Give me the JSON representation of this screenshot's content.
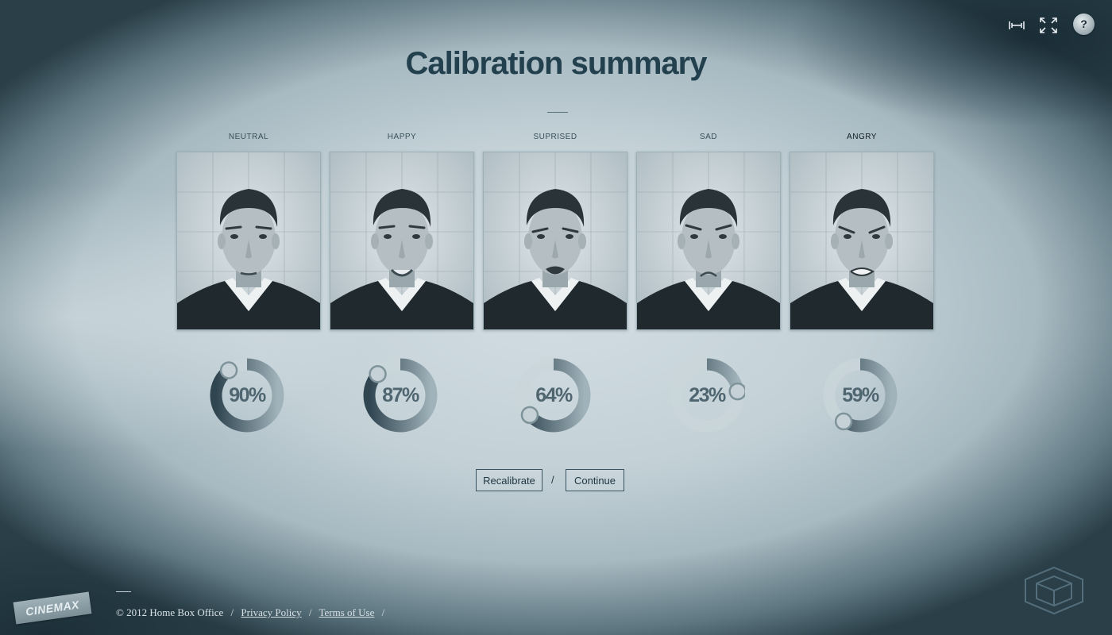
{
  "page": {
    "title": "Calibration summary"
  },
  "top_icons": [
    {
      "name": "audio-icon"
    },
    {
      "name": "fullscreen-icon"
    },
    {
      "name": "help-icon",
      "label": "?"
    }
  ],
  "expressions": [
    {
      "label": "NEUTRAL",
      "score": "90%",
      "value": 0.9
    },
    {
      "label": "HAPPY",
      "score": "87%",
      "value": 0.87
    },
    {
      "label": "SUPRISED",
      "score": "64%",
      "value": 0.64
    },
    {
      "label": "SAD",
      "score": "23%",
      "value": 0.23
    },
    {
      "label": "ANGRY",
      "score": "59%",
      "value": 0.59
    }
  ],
  "actions": {
    "recalibrate_label": "Recalibrate",
    "separator": "/",
    "continue_label": "Continue"
  },
  "footer": {
    "copyright": "© 2012 Home Box Office",
    "privacy_label": "Privacy Policy",
    "terms_label": "Terms of Use",
    "separator": "/"
  },
  "brand": {
    "logo_text": "CINEMAX"
  },
  "colors": {
    "ring_track": "#c9d5da",
    "ring_fill_dark": "#2f4550",
    "ring_fill_light": "#a0b2ba",
    "title": "#22404d"
  }
}
